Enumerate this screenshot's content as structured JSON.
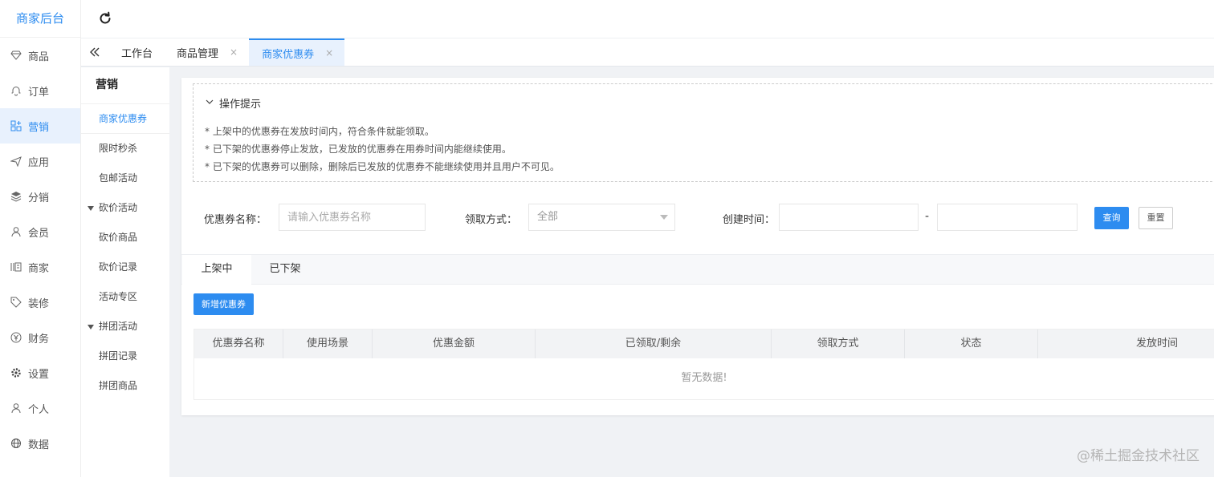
{
  "brand": "商家后台",
  "nav": [
    {
      "label": "商品",
      "icon": "diamond-icon"
    },
    {
      "label": "订单",
      "icon": "bell-icon"
    },
    {
      "label": "营销",
      "icon": "grid-icon"
    },
    {
      "label": "应用",
      "icon": "send-icon"
    },
    {
      "label": "分销",
      "icon": "layers-icon"
    },
    {
      "label": "会员",
      "icon": "user-icon"
    },
    {
      "label": "商家",
      "icon": "shop-icon"
    },
    {
      "label": "装修",
      "icon": "tag-icon"
    },
    {
      "label": "财务",
      "icon": "yen-icon"
    },
    {
      "label": "设置",
      "icon": "gear-icon"
    },
    {
      "label": "个人",
      "icon": "person-icon"
    },
    {
      "label": "数据",
      "icon": "globe-icon"
    }
  ],
  "tabs": [
    {
      "label": "工作台",
      "closable": false
    },
    {
      "label": "商品管理",
      "closable": true
    },
    {
      "label": "商家优惠券",
      "closable": true
    }
  ],
  "tab_close_glyph": "×",
  "sub": {
    "title": "营销",
    "items": [
      {
        "label": "商家优惠券",
        "type": "item"
      },
      {
        "label": "限时秒杀",
        "type": "item"
      },
      {
        "label": "包邮活动",
        "type": "item"
      },
      {
        "label": "砍价活动",
        "type": "group"
      },
      {
        "label": "砍价商品",
        "type": "item"
      },
      {
        "label": "砍价记录",
        "type": "item"
      },
      {
        "label": "活动专区",
        "type": "item"
      },
      {
        "label": "拼团活动",
        "type": "group"
      },
      {
        "label": "拼团记录",
        "type": "item"
      },
      {
        "label": "拼团商品",
        "type": "item"
      }
    ]
  },
  "tips": {
    "title": "操作提示",
    "lines": [
      "* 上架中的优惠券在发放时间内，符合条件就能领取。",
      "* 已下架的优惠券停止发放，已发放的优惠券在用券时间内能继续使用。",
      "* 已下架的优惠券可以删除，删除后已发放的优惠券不能继续使用并且用户不可见。"
    ]
  },
  "filter": {
    "name_label": "优惠券名称：",
    "name_placeholder": "请输入优惠券名称",
    "method_label": "领取方式：",
    "method_value": "全部",
    "time_label": "创建时间：",
    "range_sep": "-",
    "search_btn": "查询",
    "reset_btn": "重置"
  },
  "list_tabs": [
    "上架中",
    "已下架"
  ],
  "add_btn": "新增优惠券",
  "table": {
    "columns": [
      "优惠券名称",
      "使用场景",
      "优惠金额",
      "已领取/剩余",
      "领取方式",
      "状态",
      "发放时间"
    ],
    "empty": "暂无数据!"
  },
  "watermark": "@稀土掘金技术社区",
  "colors": {
    "accent": "#2d8cf0",
    "active_bg": "#e8f1fd"
  }
}
